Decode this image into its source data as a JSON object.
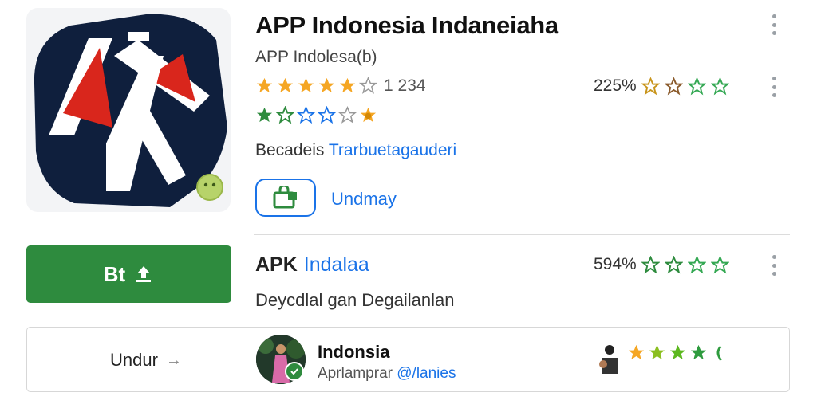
{
  "app": {
    "title": "APP Indonesia Indaneiaha",
    "subtitle": "APP Indolesa(b)",
    "rating_count": "1 234",
    "rating_stars": 4,
    "rating_percent": "225%",
    "developer_label": "Becadeis",
    "developer_link": "Trarbuetagauderi",
    "install_label": "Undmay"
  },
  "primary_button": {
    "label": "Bt"
  },
  "listing2": {
    "title": "APK",
    "title_link": "Indalaa",
    "subtitle": "Deycdlal gan Degailanlan",
    "percent": "594%"
  },
  "bottom_card": {
    "download_label": "Undur",
    "download_arrow": "→",
    "title": "Indonsia",
    "subtitle": "Aprlamprar",
    "subtitle_link": "@/lanies"
  },
  "icons": {
    "menu": "kebab-menu-icon",
    "star": "star-icon",
    "store": "store-bag-icon",
    "upload": "upload-icon",
    "verified": "verified-check-icon"
  },
  "colors": {
    "accent_blue": "#1a73e8",
    "install_green": "#2e8b3e",
    "star_gold": "#f5a623",
    "star_green": "#34a853",
    "logo_navy": "#0f1f3d",
    "logo_red": "#d9261c"
  }
}
